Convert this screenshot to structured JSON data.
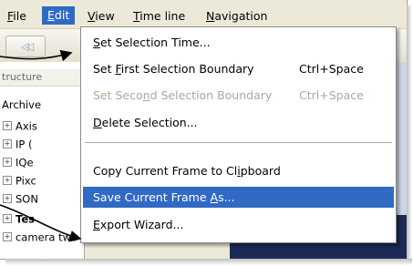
{
  "menubar": {
    "items": [
      {
        "label": "File",
        "key": "F",
        "rest": "ile"
      },
      {
        "label": "Edit",
        "key": "E",
        "rest": "dit"
      },
      {
        "label": "View",
        "key": "V",
        "rest": "iew"
      },
      {
        "label": "Time line",
        "key": "T",
        "rest": "ime line"
      },
      {
        "label": "Navigation",
        "key": "N",
        "rest": "avigation"
      }
    ]
  },
  "toolbar": {
    "back_icon": "double-chevron-left-icon",
    "back_glyph": "◁◁"
  },
  "panel": {
    "header": "tructure",
    "root": "Archive",
    "items": [
      {
        "label": "Axis",
        "bold": false
      },
      {
        "label": "IP (",
        "bold": false
      },
      {
        "label": "IQe",
        "bold": false
      },
      {
        "label": "Pixc",
        "bold": false
      },
      {
        "label": "SON",
        "bold": false
      },
      {
        "label": "Tes",
        "bold": true
      },
      {
        "label": "camera two (Group)",
        "bold": false
      }
    ]
  },
  "edit_menu": {
    "set_selection_time": {
      "pre": "",
      "key": "S",
      "post": "et Selection Time..."
    },
    "set_first_boundary": {
      "pre": "Set ",
      "key": "F",
      "post": "irst Selection Boundary",
      "shortcut": "Ctrl+Space"
    },
    "set_second_boundary": {
      "pre": "Set Seco",
      "key": "n",
      "post": "d Selection Boundary",
      "shortcut": "Ctrl+Space"
    },
    "delete_selection": {
      "pre": "",
      "key": "D",
      "post": "elete Selection..."
    },
    "copy_frame": {
      "pre": "Copy Current Frame to Cl",
      "key": "i",
      "post": "pboard"
    },
    "save_frame": {
      "pre": "Save Current Frame ",
      "key": "A",
      "post": "s..."
    },
    "export_wizard": {
      "pre": "",
      "key": "E",
      "post": "xport Wizard..."
    }
  },
  "colors": {
    "highlight": "#316ac5",
    "menubar_bg": "#ece9d8",
    "disabled_text": "#aca899",
    "viewer_bg": "#1c2a55"
  }
}
